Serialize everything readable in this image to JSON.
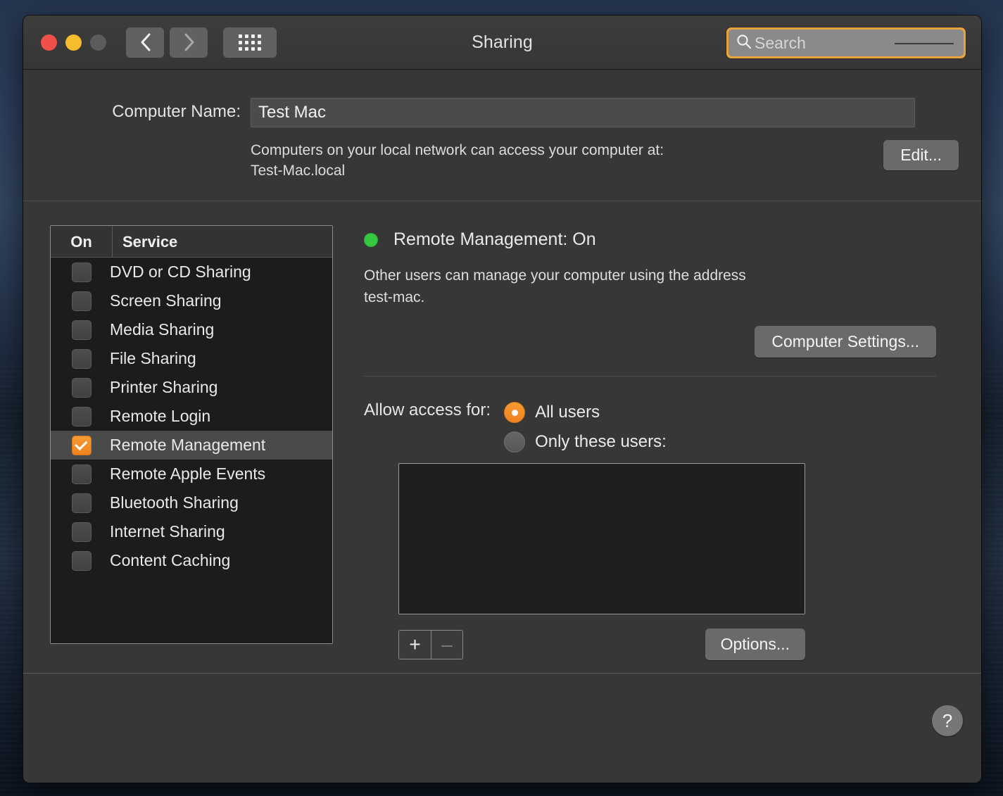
{
  "window": {
    "title": "Sharing",
    "traffic_lights": [
      "close",
      "minimize",
      "zoom"
    ],
    "back_icon": "chevron-left-icon",
    "forward_icon": "chevron-right-icon",
    "grid_icon": "show-all-grid-icon"
  },
  "search": {
    "placeholder": "Search",
    "icon": "search-icon",
    "focus_ring_color": "#e8a33d"
  },
  "computer_name": {
    "label": "Computer Name:",
    "value": "Test Mac",
    "description": "Computers on your local network can access your computer at:\nTest-Mac.local",
    "edit_label": "Edit..."
  },
  "services": {
    "columns": [
      "On",
      "Service"
    ],
    "items": [
      {
        "label": "DVD or CD Sharing",
        "checked": false,
        "selected": false
      },
      {
        "label": "Screen Sharing",
        "checked": false,
        "selected": false
      },
      {
        "label": "Media Sharing",
        "checked": false,
        "selected": false
      },
      {
        "label": "File Sharing",
        "checked": false,
        "selected": false
      },
      {
        "label": "Printer Sharing",
        "checked": false,
        "selected": false
      },
      {
        "label": "Remote Login",
        "checked": false,
        "selected": false
      },
      {
        "label": "Remote Management",
        "checked": true,
        "selected": true
      },
      {
        "label": "Remote Apple Events",
        "checked": false,
        "selected": false
      },
      {
        "label": "Bluetooth Sharing",
        "checked": false,
        "selected": false
      },
      {
        "label": "Internet Sharing",
        "checked": false,
        "selected": false
      },
      {
        "label": "Content Caching",
        "checked": false,
        "selected": false
      }
    ]
  },
  "detail": {
    "status_dot_color": "#35c840",
    "status_title": "Remote Management: On",
    "status_description": "Other users can manage your computer using the address\ntest-mac.",
    "computer_settings_label": "Computer Settings...",
    "access_label": "Allow access for:",
    "radio_options": [
      {
        "label": "All users",
        "selected": true
      },
      {
        "label": "Only these users:",
        "selected": false
      }
    ],
    "users": [],
    "add_label": "+",
    "remove_label": "–",
    "options_label": "Options..."
  },
  "footer": {
    "help_label": "?",
    "help_icon": "question-mark-icon"
  },
  "accent_color": "#ef8320"
}
